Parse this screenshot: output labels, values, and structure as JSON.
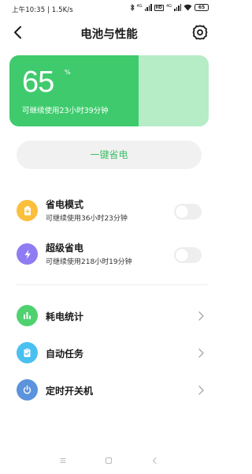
{
  "status_bar": {
    "time_speed": "上午10:35 | 1.5K/s",
    "battery_level": "65",
    "network_label": "HD",
    "signal_label_1": "4G",
    "signal_label_2": "4G"
  },
  "header": {
    "title": "电池与性能"
  },
  "battery": {
    "percent": "65",
    "percent_unit": "%",
    "level_fraction": 0.65,
    "remaining": "可继续使用23小时39分钟",
    "fill_color": "#3fcb6d",
    "track_color": "#b6ecc6"
  },
  "onekey": {
    "label": "一键省电"
  },
  "modes": [
    {
      "title": "省电模式",
      "subtitle": "可继续使用36小时23分钟",
      "icon": "battery-saver-icon",
      "icon_color": "#fbbf3c",
      "enabled": false
    },
    {
      "title": "超级省电",
      "subtitle": "可继续使用218小时19分钟",
      "icon": "lightning-icon",
      "icon_color": "#8f7cf2",
      "enabled": false
    }
  ],
  "list": [
    {
      "label": "耗电统计",
      "icon": "bar-chart-icon",
      "icon_color": "#4fd170"
    },
    {
      "label": "自动任务",
      "icon": "clipboard-check-icon",
      "icon_color": "#4ac0f0"
    },
    {
      "label": "定时开关机",
      "icon": "power-icon",
      "icon_color": "#5b93dc"
    }
  ]
}
